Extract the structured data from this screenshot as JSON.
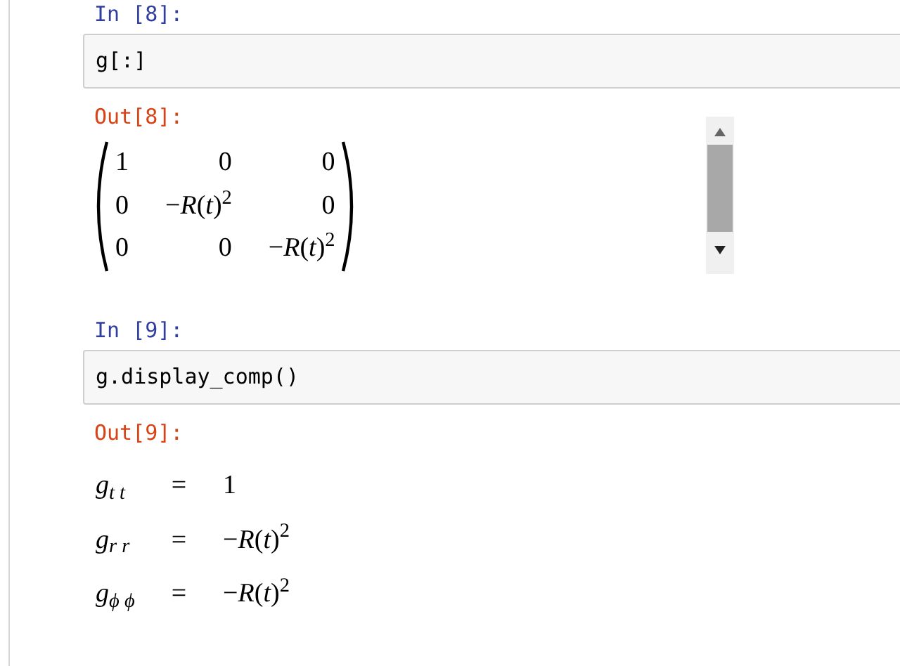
{
  "cells": [
    {
      "prompt_in": "In [8]:",
      "code": "g[:]",
      "prompt_out": "Out[8]:",
      "output": {
        "kind": "matrix",
        "rows": [
          [
            "1",
            "0",
            "0"
          ],
          [
            "0",
            "−*R*(*t*)$^{2}$",
            "0"
          ],
          [
            "0",
            "0",
            "−*R*(*t*)$^{2}$"
          ]
        ]
      }
    },
    {
      "prompt_in": "In [9]:",
      "code": "g.display_comp()",
      "prompt_out": "Out[9]:",
      "output": {
        "kind": "equations",
        "rows": [
          {
            "lhs": "g$_{t t}$",
            "rel": "=",
            "rhs": "1"
          },
          {
            "lhs": "g$_{r r}$",
            "rel": "=",
            "rhs": "−*R*(*t*)$^{2}$"
          },
          {
            "lhs": "g$_{ϕ ϕ}$",
            "rel": "=",
            "rhs": "−*R*(*t*)$^{2}$"
          }
        ]
      }
    }
  ]
}
